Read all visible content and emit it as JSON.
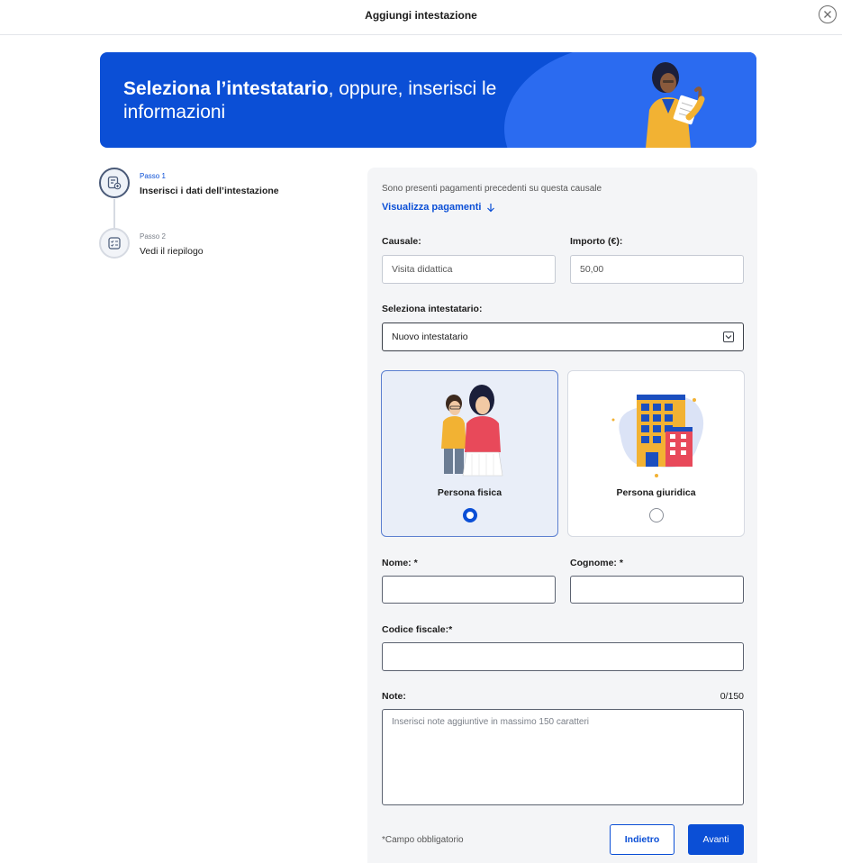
{
  "header": {
    "title": "Aggiungi intestazione",
    "close_icon": "close-icon"
  },
  "banner": {
    "title_bold": "Seleziona l’intestatario",
    "title_rest": ", oppure, inserisci le informazioni",
    "bg_color": "#0b4fd6"
  },
  "stepper": {
    "steps": [
      {
        "small": "Passo 1",
        "label": "Inserisci i dati dell’intestazione",
        "status": "active",
        "icon": "form-edit-icon"
      },
      {
        "small": "Passo 2",
        "label": "Vedi il riepilogo",
        "status": "inactive",
        "icon": "checklist-icon"
      }
    ]
  },
  "form": {
    "previous_payments_note": "Sono presenti pagamenti precedenti su questa causale",
    "view_payments_link": "Visualizza pagamenti",
    "causale": {
      "label": "Causale:",
      "value": "Visita didattica"
    },
    "importo": {
      "label": "Importo (€):",
      "value": "50,00"
    },
    "intestatario": {
      "label": "Seleziona intestatario:",
      "value": "Nuovo intestatario"
    },
    "person_types": [
      {
        "label": "Persona fisica",
        "selected": true
      },
      {
        "label": "Persona giuridica",
        "selected": false
      }
    ],
    "nome": {
      "label": "Nome: *",
      "value": ""
    },
    "cognome": {
      "label": "Cognome: *",
      "value": ""
    },
    "codice_fiscale": {
      "label": "Codice fiscale:*",
      "value": ""
    },
    "note": {
      "label": "Note:",
      "counter": "0/150",
      "placeholder": "Inserisci note aggiuntive in massimo 150 caratteri"
    },
    "required_note": "*Campo obbligatorio",
    "back_button": "Indietro",
    "next_button": "Avanti"
  }
}
